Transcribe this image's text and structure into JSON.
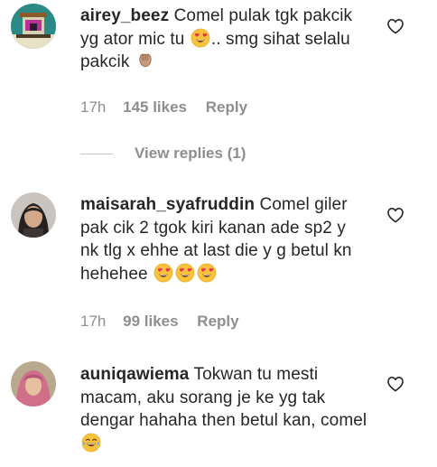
{
  "comments": [
    {
      "username": "airey_beez",
      "text_parts": [
        "Comel pulak tgk pakcik yg ator mic tu ",
        ".. smg sihat selalu pakcik "
      ],
      "emojis": [
        "heart-eyes-emoji",
        "clapping-hands-emoji"
      ],
      "time": "17h",
      "likes": "145 likes",
      "reply": "Reply",
      "view_replies": "View replies (1)"
    },
    {
      "username": "maisarah_syafruddin",
      "text_parts": [
        "Comel giler pak cik 2 tgok kiri kanan ade sp2 y nk tlg x ehhe at last die y g betul kn hehehee "
      ],
      "emojis": [
        "heart-eyes-emoji",
        "heart-eyes-emoji",
        "heart-eyes-emoji"
      ],
      "time": "17h",
      "likes": "99 likes",
      "reply": "Reply"
    },
    {
      "username": "auniqawiema",
      "text_parts": [
        "Tokwan tu mesti macam, aku sorang je ke yg tak dengar hahaha then betul kan, comel "
      ],
      "emojis": [
        "tears-of-joy-emoji"
      ]
    }
  ],
  "icons": {
    "like": "heart-outline-icon"
  },
  "colors": {
    "text": "#262626",
    "secondary": "#8e8e8e",
    "divider": "#c7c7c7"
  }
}
